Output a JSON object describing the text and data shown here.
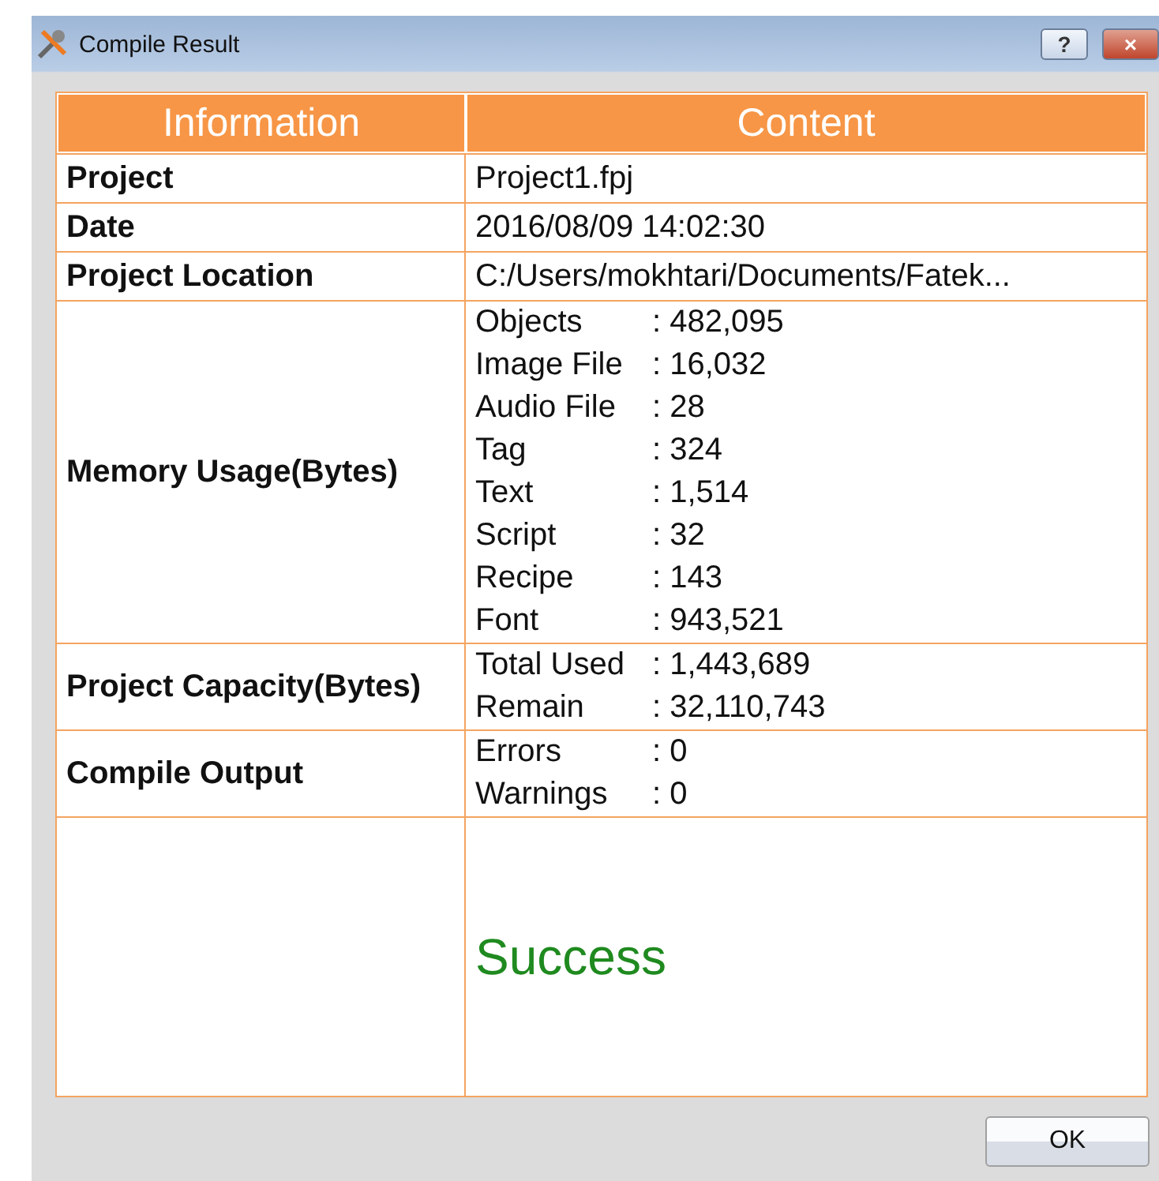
{
  "window": {
    "title": "Compile Result",
    "title_buttons": [
      "?",
      "×"
    ]
  },
  "table": {
    "columns": [
      "Information",
      "Content"
    ],
    "rows": [
      {
        "label": "Project",
        "kind": "text",
        "value": "Project1.fpj"
      },
      {
        "label": "Date",
        "kind": "text",
        "value": "2016/08/09 14:02:30"
      },
      {
        "label": "Project Location",
        "kind": "text",
        "value": "C:/Users/mokhtari/Documents/Fatek..."
      },
      {
        "label": "Memory Usage(Bytes)",
        "kind": "details",
        "details": [
          {
            "name": "Objects",
            "value": ": 482,095"
          },
          {
            "name": "Image File",
            "value": ": 16,032"
          },
          {
            "name": "Audio File",
            "value": ": 28"
          },
          {
            "name": "Tag",
            "value": ": 324"
          },
          {
            "name": "Text",
            "value": ": 1,514"
          },
          {
            "name": "Script",
            "value": ": 32"
          },
          {
            "name": "Recipe",
            "value": ": 143"
          },
          {
            "name": "Font",
            "value": ": 943,521"
          }
        ]
      },
      {
        "label": "Project Capacity(Bytes)",
        "kind": "details",
        "details": [
          {
            "name": "Total Used",
            "value": ": 1,443,689"
          },
          {
            "name": "Remain",
            "value": ": 32,110,743"
          }
        ]
      },
      {
        "label": "Compile Output",
        "kind": "details",
        "details": [
          {
            "name": "Errors",
            "value": ": 0"
          },
          {
            "name": "Warnings",
            "value": ": 0"
          }
        ]
      },
      {
        "kind": "result",
        "value": "Success"
      }
    ]
  },
  "buttons": [
    "OK"
  ]
}
